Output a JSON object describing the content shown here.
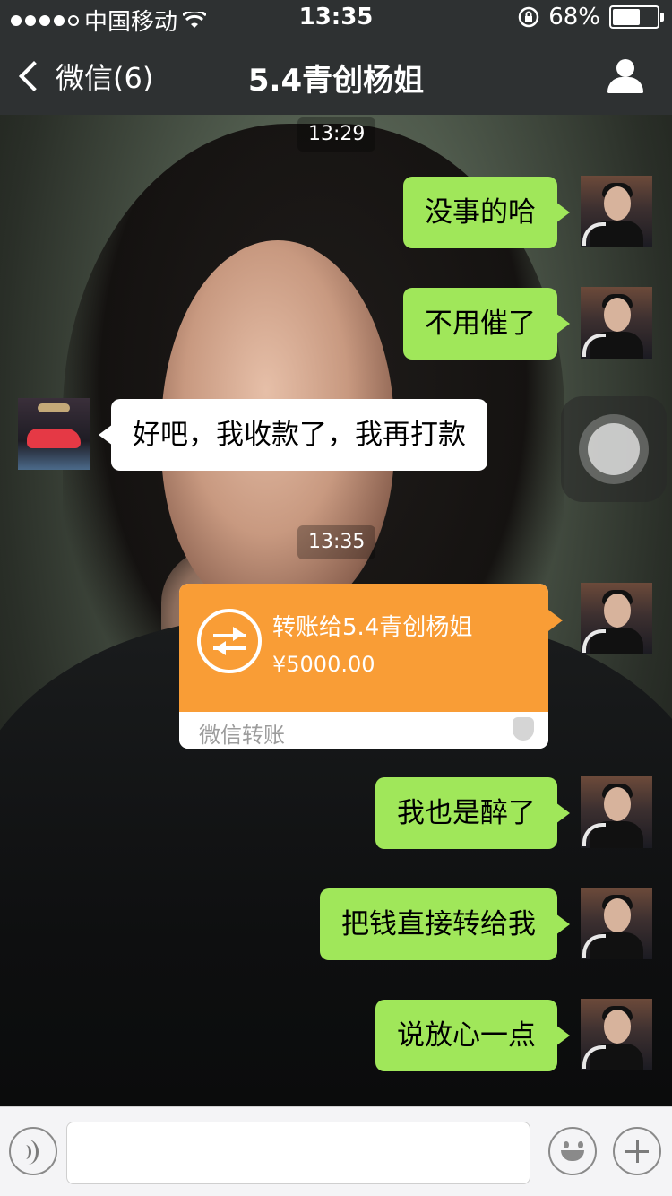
{
  "status_bar": {
    "carrier": "中国移动",
    "time": "13:35",
    "battery": "68%",
    "battery_level": 0.68
  },
  "nav": {
    "back_label": "微信(6)",
    "title": "5.4青创杨姐"
  },
  "messages": {
    "ts1": "13:29",
    "m1": "没事的哈",
    "m2": "不用催了",
    "m3": "好吧，我收款了，我再打款",
    "ts2": "13:35",
    "transfer_title": "转账给5.4青创杨姐",
    "transfer_amount": "¥5000.00",
    "transfer_footer": "微信转账",
    "m4": "我也是醉了",
    "m5": "把钱直接转给我",
    "m6": "说放心一点"
  },
  "colors": {
    "nav_bg": "#2e3132",
    "bubble_green": "#a0e75a",
    "transfer_orange": "#f99d36"
  }
}
